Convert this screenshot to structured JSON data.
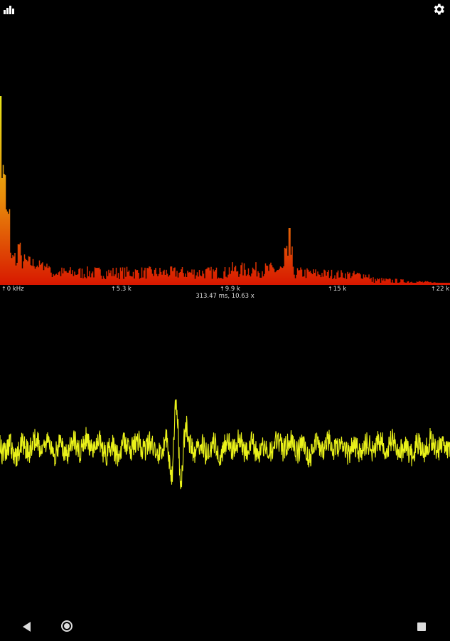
{
  "status_bar": {
    "left_icon": "bar-chart-icon",
    "right_icon": "gear-icon"
  },
  "spectrum": {
    "axis_labels": [
      "0 kHz",
      "5.3 k",
      "9.9 k",
      "15 k",
      "22 k"
    ],
    "readout": "313.47 ms, 10.63 x"
  },
  "colors": {
    "spectrum_top": "#e6e619",
    "spectrum_bottom": "#e01b00",
    "waveform": "#eaf21a",
    "background": "#000000"
  },
  "nav_bar": {
    "back_icon": "back-icon",
    "home_icon": "home-icon",
    "recents_icon": "recents-icon"
  }
}
